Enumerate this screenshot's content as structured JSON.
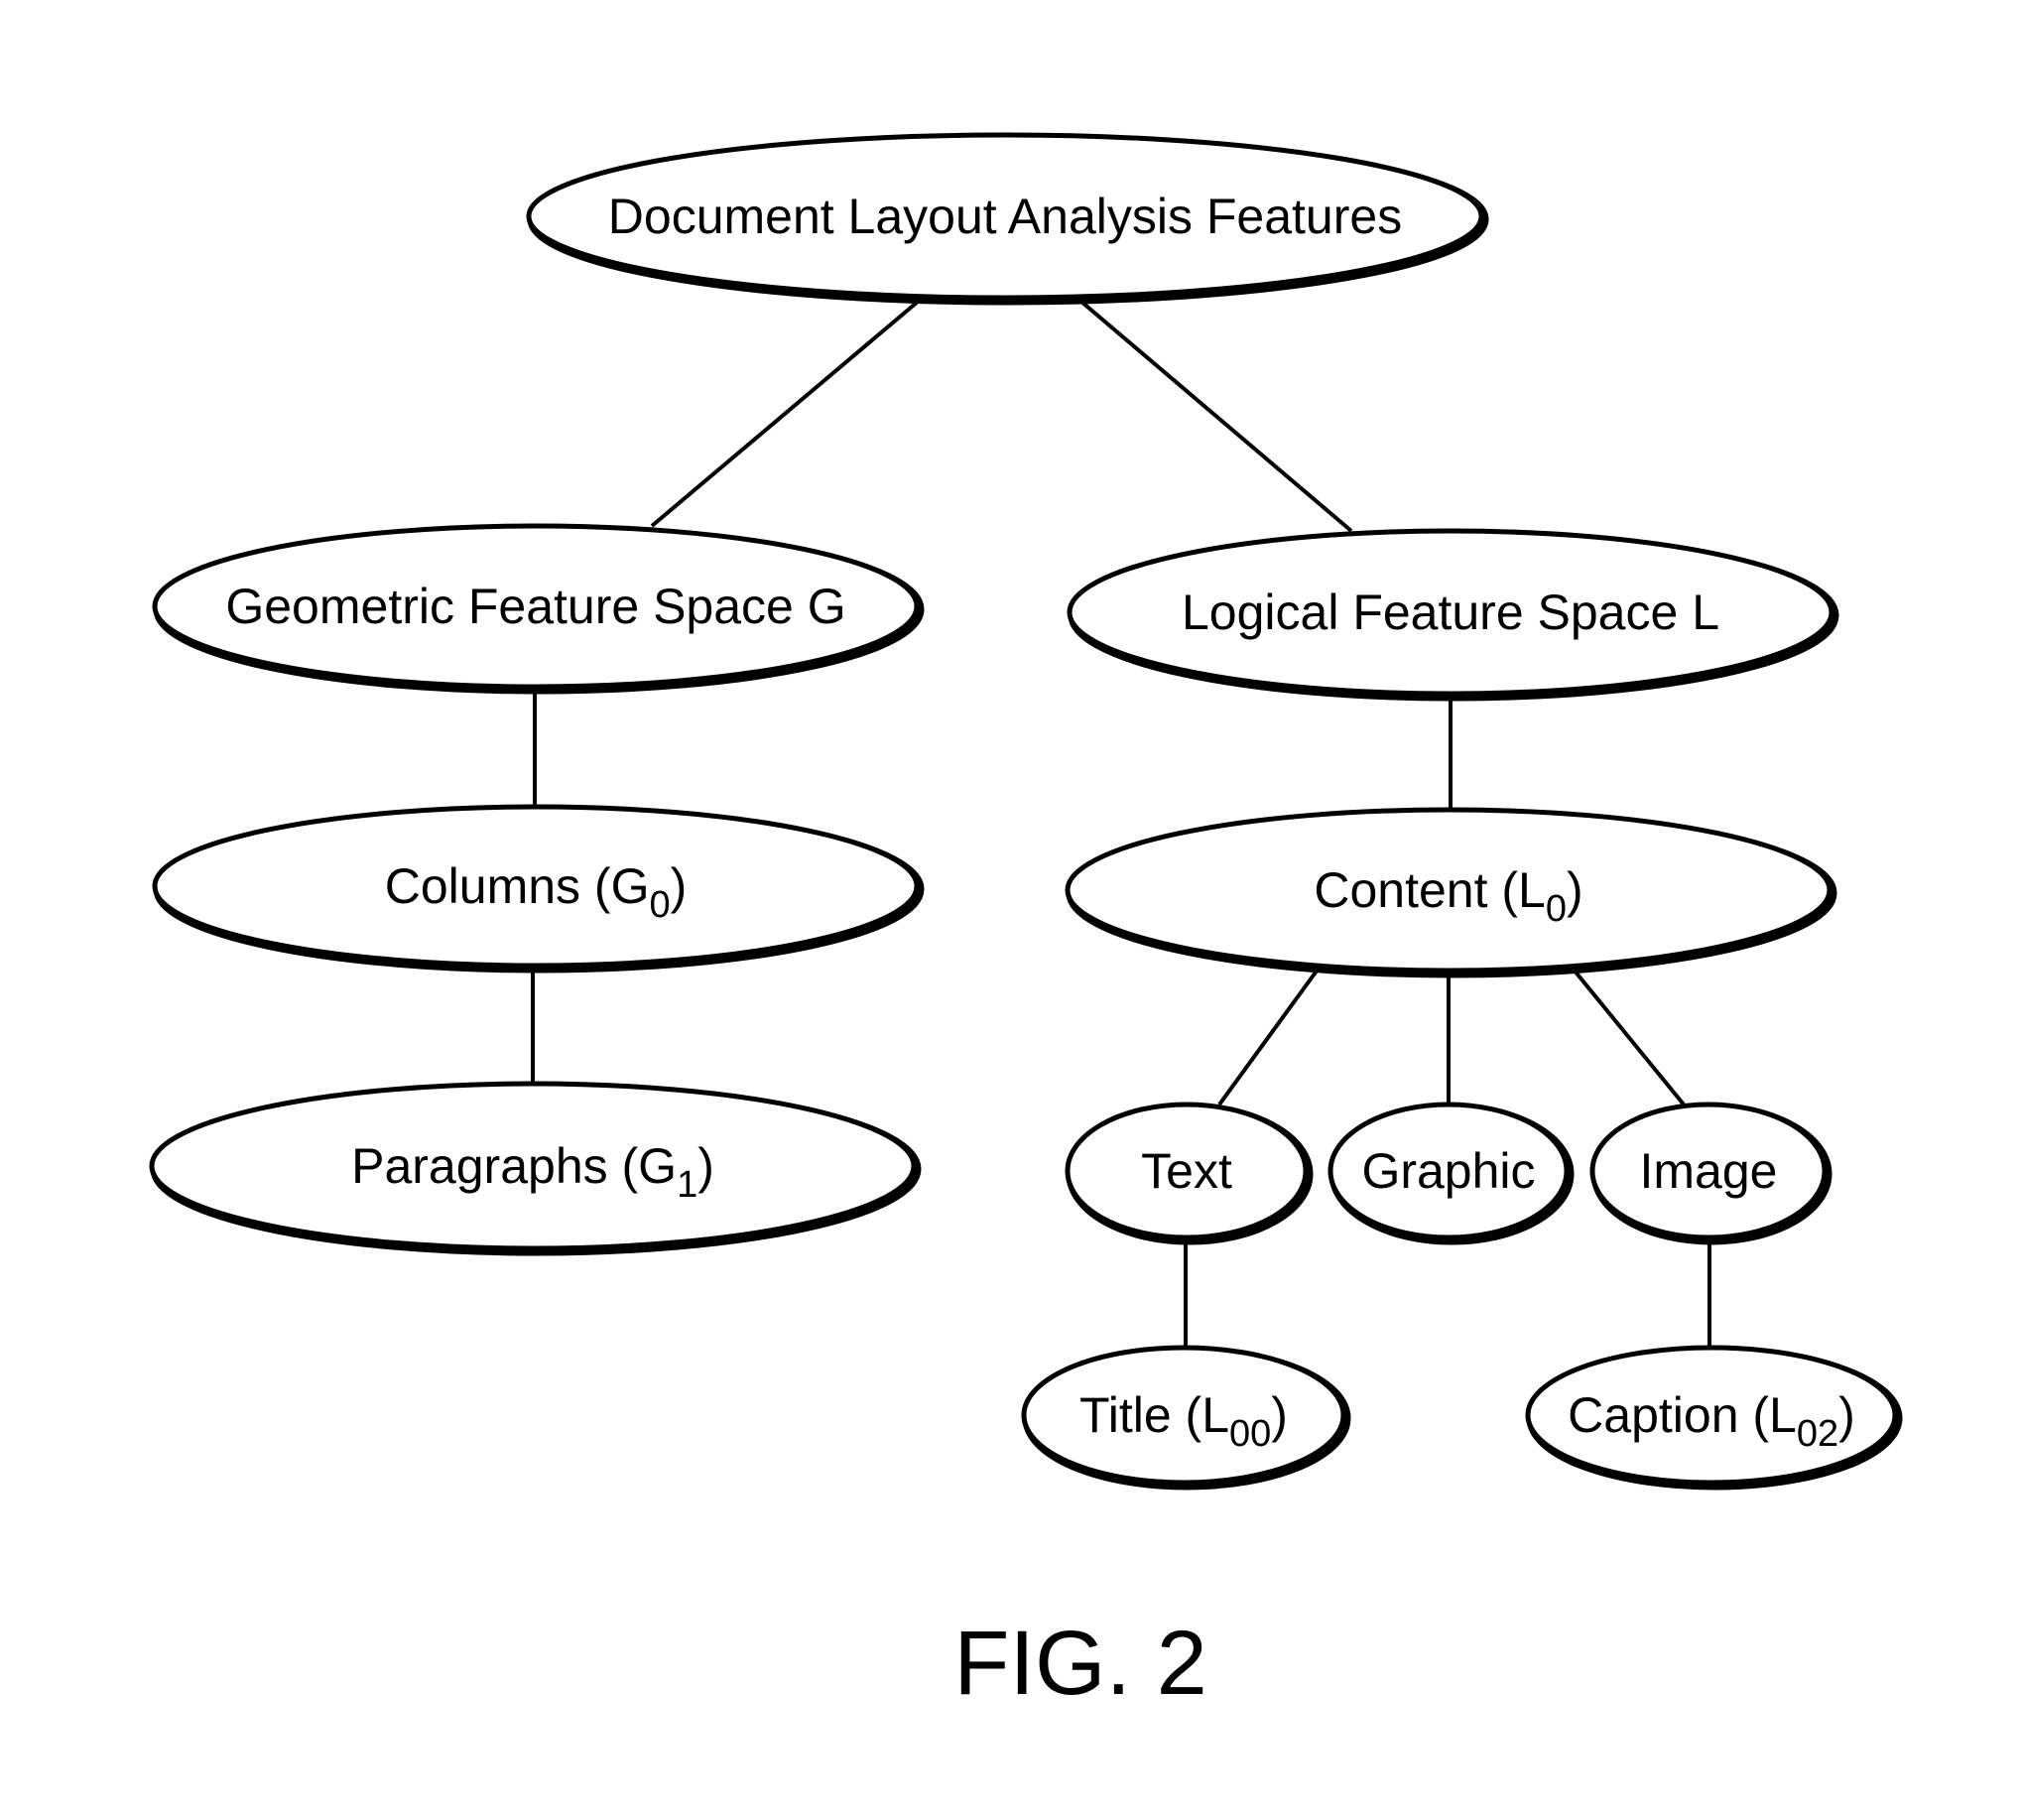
{
  "figure": {
    "caption": "FIG. 2",
    "colors": {
      "stroke": "#000000",
      "fill": "#ffffff",
      "text": "#000000"
    }
  },
  "nodes": {
    "root": {
      "text": "Document Layout Analysis Features",
      "sub": ""
    },
    "geometric": {
      "text": "Geometric Feature Space G",
      "sub": ""
    },
    "logical": {
      "text": "Logical Feature Space L",
      "sub": ""
    },
    "columns": {
      "text": "Columns (G",
      "sub": "0",
      "after": ")"
    },
    "content": {
      "text": "Content (L",
      "sub": "0",
      "after": ")"
    },
    "paragraphs": {
      "text": "Paragraphs (G",
      "sub": "1",
      "after": ")"
    },
    "text": {
      "text": "Text",
      "sub": ""
    },
    "graphic": {
      "text": "Graphic",
      "sub": ""
    },
    "image": {
      "text": "Image",
      "sub": ""
    },
    "title": {
      "text": "Title (L",
      "sub": "00",
      "after": ")"
    },
    "caption": {
      "text": "Caption (L",
      "sub": "02",
      "after": ")"
    }
  },
  "edges": [
    {
      "from": "root",
      "to": "geometric"
    },
    {
      "from": "root",
      "to": "logical"
    },
    {
      "from": "geometric",
      "to": "columns"
    },
    {
      "from": "columns",
      "to": "paragraphs"
    },
    {
      "from": "logical",
      "to": "content"
    },
    {
      "from": "content",
      "to": "text"
    },
    {
      "from": "content",
      "to": "graphic"
    },
    {
      "from": "content",
      "to": "image"
    },
    {
      "from": "text",
      "to": "title"
    },
    {
      "from": "image",
      "to": "caption"
    }
  ]
}
